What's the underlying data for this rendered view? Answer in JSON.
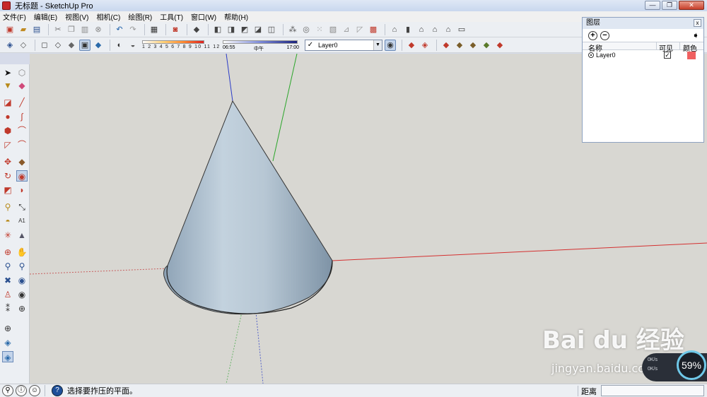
{
  "window": {
    "title": "无标题 - SketchUp Pro",
    "minimize": "—",
    "maximize": "❐",
    "close": "✕"
  },
  "menu": [
    "文件(F)",
    "编辑(E)",
    "视图(V)",
    "相机(C)",
    "绘图(R)",
    "工具(T)",
    "窗口(W)",
    "帮助(H)"
  ],
  "shadow_settings": {
    "month_ticks": "1 2 3 4 5 6 7 8 9 10 11 12",
    "time_start": "06:55",
    "time_mid": "中午",
    "time_end": "17:00"
  },
  "layer_toolbar": {
    "current_layer": "Layer0",
    "check": "✓"
  },
  "layers_panel": {
    "title": "图层",
    "close": "x",
    "columns": {
      "name": "名称",
      "visible": "可见",
      "color": "颜色"
    },
    "rows": [
      {
        "name": "Layer0",
        "visible_mark": "✓",
        "color": "#f06060"
      }
    ]
  },
  "status": {
    "message": "选择要拃压的平面。",
    "measure_label": "距离",
    "measure_value": ""
  },
  "watermark": {
    "brand": "Bai du 经验",
    "url": "jingyan.baidu.com"
  },
  "speed_widget": {
    "percent": "59%",
    "up": "0K/s",
    "down": "0K/s"
  },
  "colors": {
    "axis_red": "#d43030",
    "axis_green": "#2aa62a",
    "axis_blue": "#2b3cc8",
    "cone_light": "#c3d2de",
    "cone_dark": "#7e93a6",
    "viewport_bg": "#d8d7d2"
  }
}
